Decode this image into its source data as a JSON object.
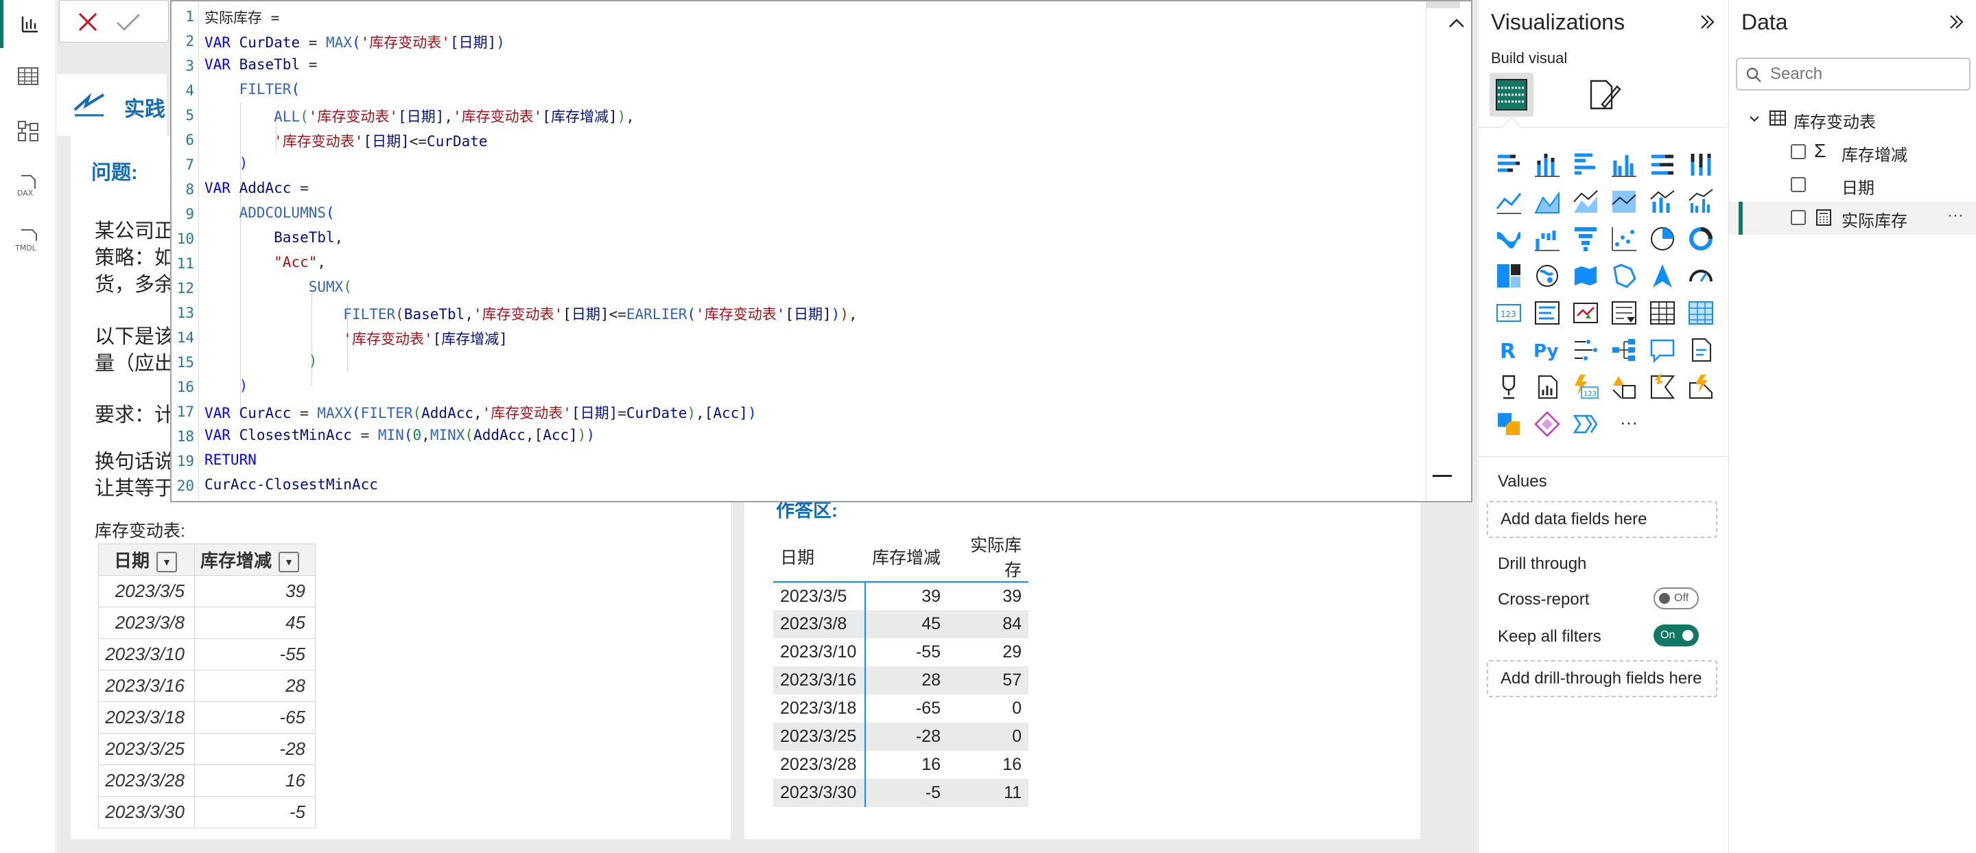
{
  "formula_bar": {
    "cancel_icon": "close-icon",
    "commit_icon": "check-icon"
  },
  "editor": {
    "lines": [
      "1",
      "2",
      "3",
      "4",
      "5",
      "6",
      "7",
      "8",
      "9",
      "10",
      "11",
      "12",
      "13",
      "14",
      "15",
      "16",
      "17",
      "18",
      "19",
      "20"
    ]
  },
  "report": {
    "title": "实践",
    "question_label": "问题:",
    "para1": [
      "某公司正",
      "策略：如",
      "货，多余"
    ],
    "para2": [
      "以下是该",
      "量（应出"
    ],
    "para3": [
      "要求：计"
    ],
    "para4": [
      "换句话说",
      "让其等于"
    ],
    "left_table_caption": "库存变动表:",
    "work_area_label": "作答区:"
  },
  "left_table": {
    "headers": [
      "日期",
      "库存增减"
    ],
    "rows": [
      [
        "2023/3/5",
        "39"
      ],
      [
        "2023/3/8",
        "45"
      ],
      [
        "2023/3/10",
        "-55"
      ],
      [
        "2023/3/16",
        "28"
      ],
      [
        "2023/3/18",
        "-65"
      ],
      [
        "2023/3/25",
        "-28"
      ],
      [
        "2023/3/28",
        "16"
      ],
      [
        "2023/3/30",
        "-5"
      ]
    ]
  },
  "right_table": {
    "headers": [
      "日期",
      "库存增减",
      "实际库存"
    ],
    "rows": [
      [
        "2023/3/5",
        "39",
        "39"
      ],
      [
        "2023/3/8",
        "45",
        "84"
      ],
      [
        "2023/3/10",
        "-55",
        "29"
      ],
      [
        "2023/3/16",
        "28",
        "57"
      ],
      [
        "2023/3/18",
        "-65",
        "0"
      ],
      [
        "2023/3/25",
        "-28",
        "0"
      ],
      [
        "2023/3/28",
        "16",
        "16"
      ],
      [
        "2023/3/30",
        "-5",
        "11"
      ]
    ]
  },
  "visualizations": {
    "title": "Visualizations",
    "build_visual": "Build visual",
    "values_label": "Values",
    "values_well": "Add data fields here",
    "drill_through": "Drill through",
    "cross_report": "Cross-report",
    "cross_report_state": "Off",
    "keep_all_filters": "Keep all filters",
    "keep_state": "On",
    "drill_well": "Add drill-through fields here",
    "more": "···"
  },
  "data_pane": {
    "title": "Data",
    "search_placeholder": "Search",
    "table_name": "库存变动表",
    "fields": [
      "库存增减",
      "日期",
      "实际库存"
    ],
    "more": "···"
  },
  "colors": {
    "accent": "#117865",
    "dax_keyword": "#0000ff",
    "dax_string": "#a31515",
    "link_blue": "#0f6cbd"
  }
}
